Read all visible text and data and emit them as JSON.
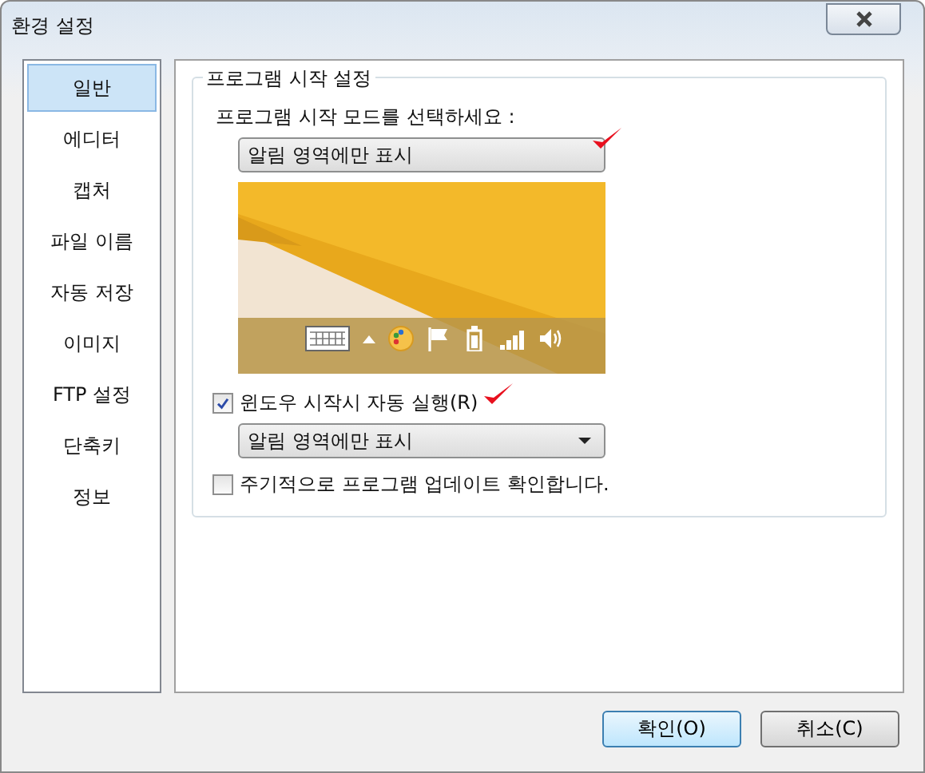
{
  "window": {
    "title": "환경 설정"
  },
  "sidebar": {
    "items": [
      {
        "label": "일반",
        "selected": true
      },
      {
        "label": "에디터",
        "selected": false
      },
      {
        "label": "캡처",
        "selected": false
      },
      {
        "label": "파일 이름",
        "selected": false
      },
      {
        "label": "자동 저장",
        "selected": false
      },
      {
        "label": "이미지",
        "selected": false
      },
      {
        "label": "FTP 설정",
        "selected": false
      },
      {
        "label": "단축키",
        "selected": false
      },
      {
        "label": "정보",
        "selected": false
      }
    ]
  },
  "group": {
    "title": "프로그램 시작 설정",
    "items": [
      {
        "kind": "label",
        "text": "프로그램 시작 모드를 선택하세요 :"
      },
      {
        "kind": "dropdown",
        "value": "알림 영역에만 표시",
        "annotated": true,
        "arrow": false
      },
      {
        "kind": "preview"
      },
      {
        "kind": "checkbox",
        "label": "윈도우 시작시 자동 실행(R)",
        "checked": true,
        "annotated": true
      },
      {
        "kind": "dropdown",
        "value": "알림 영역에만 표시",
        "annotated": false,
        "arrow": true
      },
      {
        "kind": "checkbox",
        "label": "주기적으로 프로그램 업데이트 확인합니다.",
        "checked": false,
        "annotated": false
      }
    ]
  },
  "buttons": [
    {
      "label": "확인(O)",
      "default": true
    },
    {
      "label": "취소(C)",
      "default": false
    }
  ]
}
